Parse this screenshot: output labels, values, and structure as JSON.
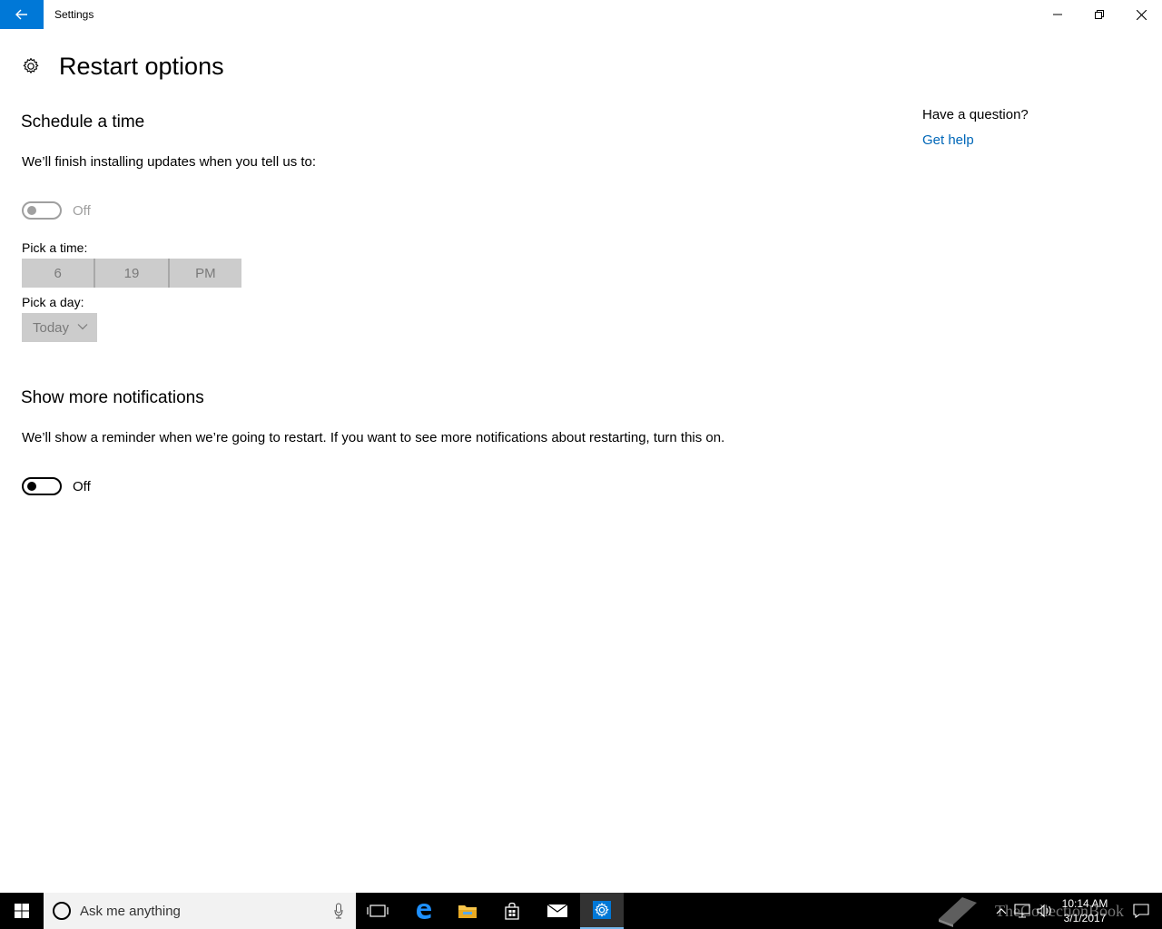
{
  "window": {
    "app_title": "Settings",
    "back_icon": "arrow-left-icon",
    "minimize_icon": "minimize-icon",
    "maximize_icon": "restore-icon",
    "close_icon": "close-icon",
    "accent_color": "#0078d7"
  },
  "header": {
    "icon": "gear-icon",
    "title": "Restart options"
  },
  "schedule": {
    "title": "Schedule a time",
    "description": "We’ll finish installing updates when you tell us to:",
    "toggle_state": "Off",
    "toggle_enabled": false,
    "time_label": "Pick a time:",
    "time": {
      "hour": "6",
      "minute": "19",
      "period": "PM"
    },
    "day_label": "Pick a day:",
    "day_value": "Today"
  },
  "notifications": {
    "title": "Show more notifications",
    "description": "We’ll show a reminder when we’re going to restart. If you want to see more notifications about restarting, turn this on.",
    "toggle_state": "Off",
    "toggle_enabled": true
  },
  "aside": {
    "question": "Have a question?",
    "help_link": "Get help",
    "link_color": "#0067b8"
  },
  "taskbar": {
    "search_placeholder": "Ask me anything",
    "pinned": [
      "task-view-icon",
      "edge-icon",
      "file-explorer-icon",
      "store-icon",
      "mail-icon",
      "settings-icon"
    ],
    "active_app": "settings-icon",
    "clock_time": "10:14 AM",
    "clock_date": "3/1/2017",
    "watermark": "TheCollectionBook"
  }
}
